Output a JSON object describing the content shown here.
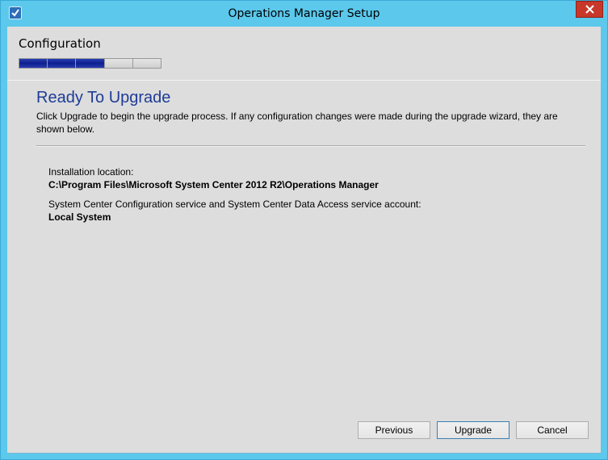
{
  "window": {
    "title": "Operations Manager Setup",
    "app_icon": "setup-check-icon",
    "close_icon": "close-icon",
    "accent_color": "#5bc8ec",
    "close_color": "#c7382b"
  },
  "header": {
    "stage_title": "Configuration",
    "progress": {
      "filled_segments": 3,
      "total_segments": 5,
      "fill_color": "#1a2d9e"
    }
  },
  "main": {
    "heading": "Ready To Upgrade",
    "intro": "Click Upgrade to begin the upgrade process. If any configuration changes were made during the upgrade wizard, they are shown below.",
    "items": [
      {
        "label": "Installation location:",
        "value": "C:\\Program Files\\Microsoft System Center 2012 R2\\Operations Manager"
      },
      {
        "label": "System Center Configuration service and System Center Data Access service account:",
        "value": "Local System"
      }
    ]
  },
  "buttons": {
    "previous": "Previous",
    "upgrade": "Upgrade",
    "cancel": "Cancel"
  }
}
